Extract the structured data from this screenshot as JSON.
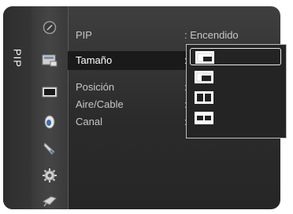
{
  "sidebar": {
    "label": "PIP"
  },
  "icons": [
    "picture-icon",
    "sound-icon",
    "channel-icon",
    "setup-icon",
    "input-icon",
    "application-icon",
    "support-icon"
  ],
  "menu": {
    "rows": [
      {
        "label": "PIP",
        "value": ": Encendido"
      },
      {
        "label": "Tamaño",
        "value": ":"
      },
      {
        "label": "Posición",
        "value": ":"
      },
      {
        "label": "Aire/Cable",
        "value": ":"
      },
      {
        "label": "Canal",
        "value": ":"
      }
    ],
    "selected_row": "Tamaño"
  },
  "size_options": [
    {
      "name": "small-pip-size-icon",
      "selected": true
    },
    {
      "name": "large-pip-size-icon",
      "selected": false
    },
    {
      "name": "split-screen-size-icon",
      "selected": false
    },
    {
      "name": "double-small-size-icon",
      "selected": false
    }
  ],
  "colors": {
    "panel": "#2b2b2b",
    "highlight": "#1a1a1a",
    "text": "#c7c7c7",
    "text_active": "#ffffff"
  }
}
